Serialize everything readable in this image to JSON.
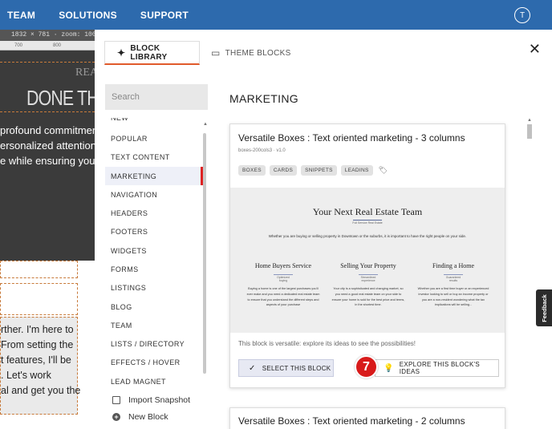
{
  "nav": {
    "items": [
      "TEAM",
      "SOLUTIONS",
      "SUPPORT"
    ],
    "avatar_letter": "T"
  },
  "background": {
    "toolbar_text": "1832 × 781 · zoom: 100",
    "ruler": [
      "700",
      "800"
    ],
    "banner_small": "REA",
    "banner_big": "DONE THE",
    "dark_lines": [
      "profound commitment",
      "ersonalized attention,",
      "e while ensuring your"
    ],
    "light_lines": [
      "rther. I'm here to",
      "From setting the",
      "t features, I'll be",
      ". Let's work",
      "al and get you the"
    ]
  },
  "modal": {
    "tabs": [
      {
        "label": "BLOCK LIBRARY",
        "icon": "magic-wand-icon"
      },
      {
        "label": "THEME BLOCKS",
        "icon": "theme-icon"
      }
    ],
    "close_glyph": "✕",
    "search_placeholder": "Search",
    "categories": [
      "NEW",
      "POPULAR",
      "TEXT CONTENT",
      "MARKETING",
      "NAVIGATION",
      "HEADERS",
      "FOOTERS",
      "WIDGETS",
      "FORMS",
      "LISTINGS",
      "BLOG",
      "TEAM",
      "LISTS / DIRECTORY",
      "EFFECTS / HOVER",
      "LEAD MAGNET"
    ],
    "active_category": "MARKETING",
    "actions": {
      "import": "Import Snapshot",
      "new_block": "New Block"
    },
    "section_title": "MARKETING",
    "card": {
      "title": "Versatile Boxes : Text oriented marketing - 3 columns",
      "subtitle": "boxes-200cols3 · v1.0",
      "tags": [
        "BOXES",
        "CARDS",
        "SNIPPETS",
        "LEADINS"
      ],
      "preview": {
        "title": "Your Next Real Estate Team",
        "subtitle": "Full Service Real Estate",
        "intro": "Whether you are buying or selling property in Downtown or the suburbs, it is important to have the right people on your side.",
        "columns": [
          {
            "heading": "Home Buyers Service",
            "tag": "Optimized buying",
            "text": "Buying a home is one of the largest purchases you'll ever make and you need a dedicated real estate team to ensure that you understand the different steps and aspects of your purchase"
          },
          {
            "heading": "Selling Your Property",
            "tag": "Streamlined experience",
            "text": "Your city is a sophisticated and changing market, so you need a good real estate team on your side to ensure your home is sold for the best price and terms, in the shortest time."
          },
          {
            "heading": "Finding a Home",
            "tag": "Guaranteed results",
            "text": "Whether you are a first time buyer or an experienced investor looking to sell or buy an income property or you are a non-resident wondering what the tax implications will be selling..."
          }
        ]
      },
      "description": "This block is versatile: explore its ideas to see the possibilities!",
      "select_label": "SELECT THIS BLOCK",
      "explore_label": "EXPLORE THIS BLOCK'S IDEAS",
      "step_number": "7"
    },
    "card2": {
      "title": "Versatile Boxes : Text oriented marketing - 2 columns"
    }
  },
  "feedback_label": "Feedback",
  "colors": {
    "nav": "#2d6aad",
    "active_tab_underline": "#e05a2b",
    "active_marker": "#dd2222",
    "step_badge": "#d81b1b"
  }
}
